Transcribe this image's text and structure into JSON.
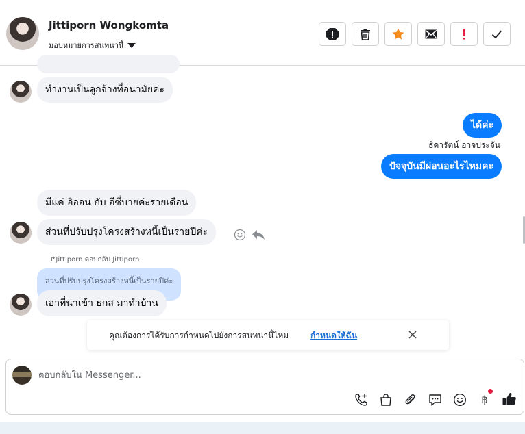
{
  "header": {
    "contact_name": "Jittiporn Wongkomta",
    "assign_label": "มอบหมายการสนทนานี้",
    "actions": [
      {
        "name": "spam-icon",
        "color": "#1c1e21"
      },
      {
        "name": "trash-icon",
        "color": "#1c1e21"
      },
      {
        "name": "star-icon",
        "color": "#f28b1d"
      },
      {
        "name": "envelope-icon",
        "color": "#1c1e21"
      },
      {
        "name": "exclamation-icon",
        "color": "#e41e3f"
      },
      {
        "name": "check-icon",
        "color": "#1c1e21"
      }
    ]
  },
  "messages": {
    "m1": "ทำงานเป็นลูกจ้างที่อนามัยค่ะ",
    "m2": "ได้ค่ะ",
    "m2_sender": "ธิดารัตน์ อาจประจัน",
    "m3": "ปัจจุบันมีผ่อนอะไรไหมคะ",
    "m4": "มีแค่ อิออน กับ อีซี่บายค่ะรายเดือน",
    "m5": "ส่วนที่ปรับปรุงโครงสร้างหนี้เป็นรายปีค่ะ",
    "reply_meta": "Jittiporn ตอบกลับ Jittiporn",
    "quoted": "ส่วนที่ปรับปรุงโครงสร้างหนี้เป็นรายปีค่ะ",
    "m6": "เอาที่นาเข้า ธกส มาทำบ้าน"
  },
  "prompt": {
    "text": "คุณต้องการได้รับการกำหนดไปยังการสนทนานี้ไหม",
    "link": "กำหนดให้ฉัน"
  },
  "composer": {
    "placeholder": "ตอบกลับใน Messenger...",
    "baht_symbol": "฿",
    "tools": [
      "call-add-icon",
      "shopping-bag-icon",
      "paperclip-icon",
      "chat-bubble-icon",
      "emoji-icon",
      "baht-icon",
      "thumbs-up-icon"
    ]
  },
  "colors": {
    "outgoing_bubble": "#0a7cff",
    "incoming_bubble": "#f0f2f5",
    "quoted_bubble": "#cfe2ff",
    "link": "#1a6ed8"
  }
}
